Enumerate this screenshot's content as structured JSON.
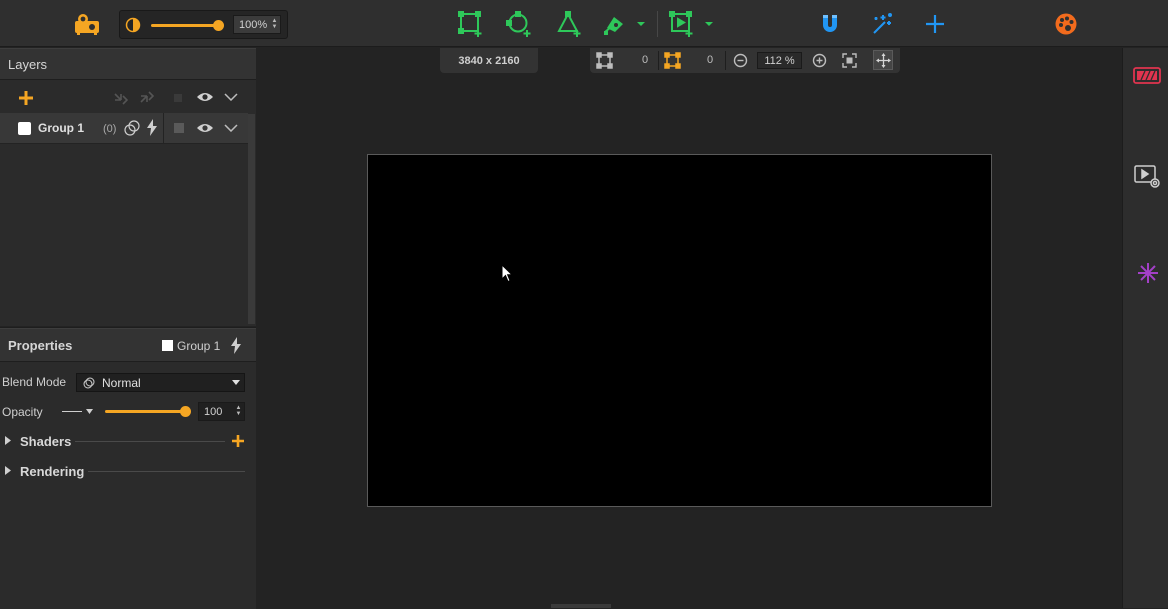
{
  "toolbar": {
    "brightness_value": "100%",
    "icons": [
      "projector-icon",
      "brightness-icon",
      "add-quad-icon",
      "add-circle-icon",
      "add-triangle-icon",
      "pen-tool-icon",
      "add-surface-icon",
      "magnet-icon",
      "magic-wand-icon",
      "crosshair-icon",
      "palette-icon"
    ]
  },
  "canvas": {
    "resolution": "3840 x 2160",
    "input_count": "0",
    "output_count": "0",
    "zoom": "112 %"
  },
  "layers": {
    "title": "Layers",
    "group": {
      "name": "Group 1",
      "count": "(0)"
    }
  },
  "properties": {
    "title": "Properties",
    "group_name": "Group 1",
    "blend_mode_label": "Blend Mode",
    "blend_mode_value": "Normal",
    "opacity_label": "Opacity",
    "opacity_value": "100",
    "shaders_label": "Shaders",
    "rendering_label": "Rendering"
  },
  "colors": {
    "accent": "#f5a623",
    "green_tools": "#2ec85a",
    "blue_tools": "#2196f3",
    "palette": "#f26b1d",
    "output_red": "#e0344f",
    "purple": "#a340c8"
  }
}
